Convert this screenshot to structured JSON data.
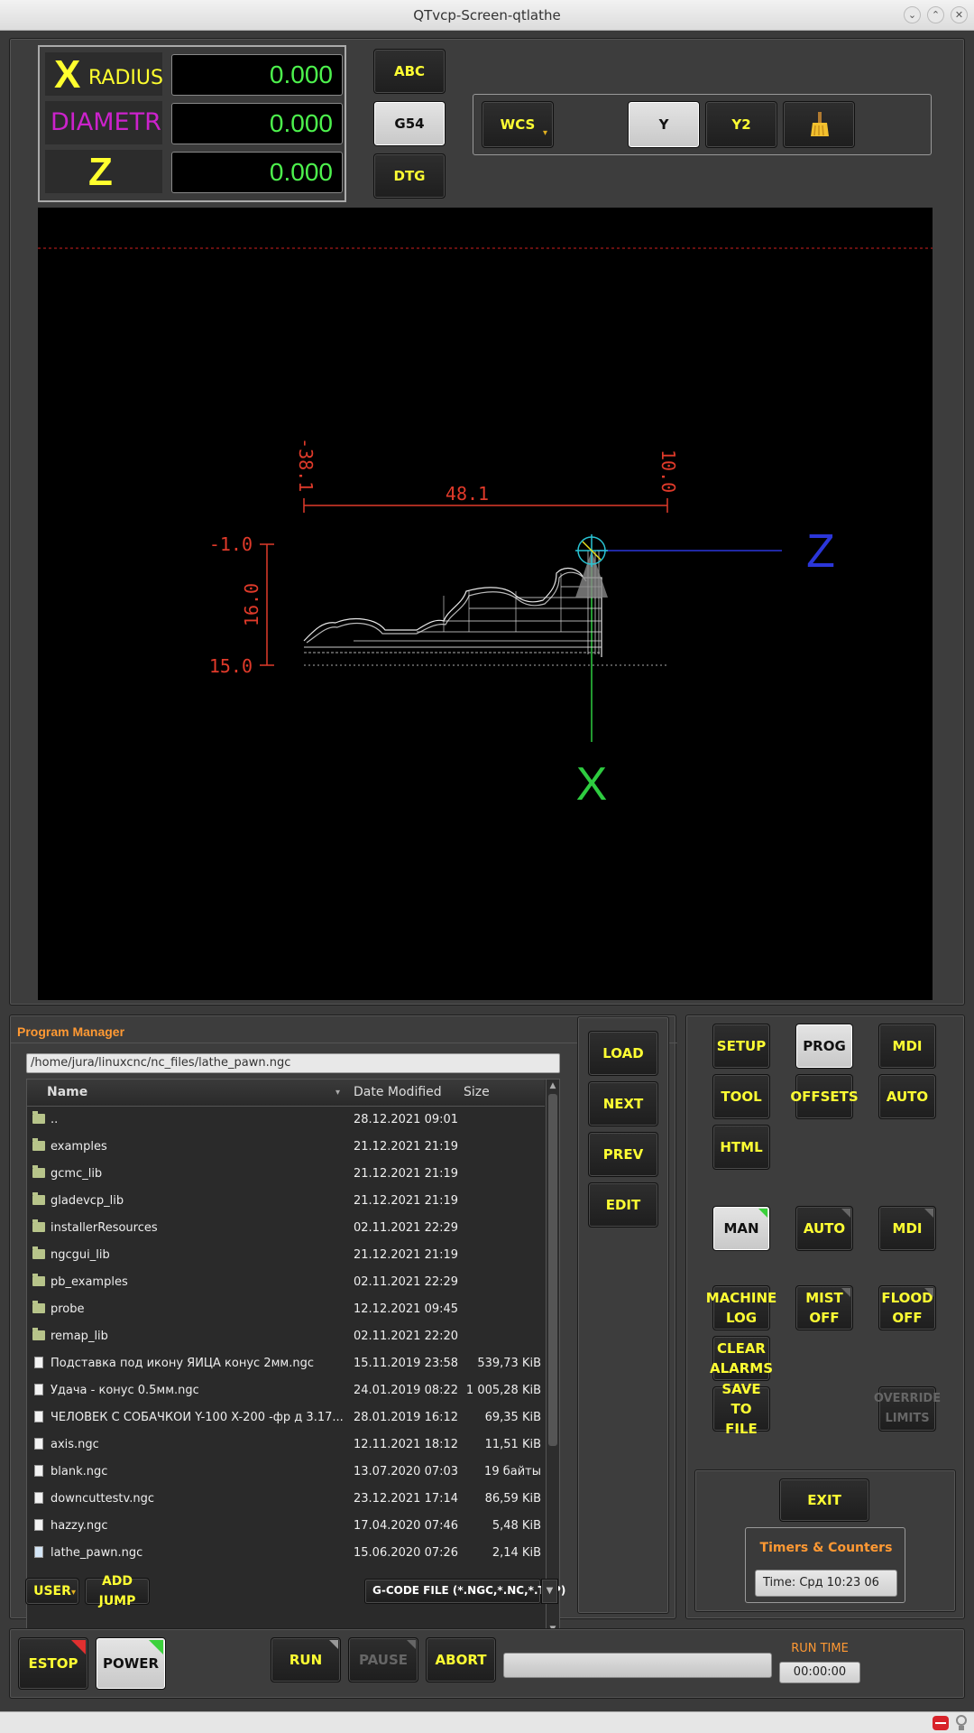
{
  "window": {
    "title": "QTvcp-Screen-qtlathe"
  },
  "dro": {
    "x_letter": "X",
    "x_sub": "RADIUS",
    "x_value": "0.000",
    "d_label": "DIAMETR",
    "d_value": "0.000",
    "z_letter": "Z",
    "z_value": "0.000"
  },
  "dro_buttons": {
    "abc": "ABC",
    "g54": "G54",
    "dtg": "DTG"
  },
  "view_buttons": {
    "wcs": "WCS",
    "y": "Y",
    "y2": "Y2",
    "clear_icon": "broom-icon"
  },
  "graphics": {
    "dim_top": "48.1",
    "dim_top_left": "-38.1",
    "dim_top_right": "10.0",
    "dim_left": "16.0",
    "dim_left_top": "-1.0",
    "dim_left_bottom": "15.0",
    "axis_z": "Z",
    "axis_x": "X",
    "colors": {
      "dimension": "#e03a2a",
      "z_axis": "#2b36d9",
      "x_axis": "#2ecc40",
      "toolpath": "#e8e8e8",
      "tool": "#29c4d4"
    }
  },
  "program_manager": {
    "title": "Program Manager",
    "path": "/home/jura/linuxcnc/nc_files/lathe_pawn.ngc",
    "columns": {
      "name": "Name",
      "date": "Date Modified",
      "size": "Size"
    },
    "files": [
      {
        "name": "..",
        "date": "28.12.2021 09:01",
        "size": "",
        "type": "folder"
      },
      {
        "name": "examples",
        "date": "21.12.2021 21:19",
        "size": "",
        "type": "folder"
      },
      {
        "name": "gcmc_lib",
        "date": "21.12.2021 21:19",
        "size": "",
        "type": "folder"
      },
      {
        "name": "gladevcp_lib",
        "date": "21.12.2021 21:19",
        "size": "",
        "type": "folder"
      },
      {
        "name": "installerResources",
        "date": "02.11.2021 22:29",
        "size": "",
        "type": "folder"
      },
      {
        "name": "ngcgui_lib",
        "date": "21.12.2021 21:19",
        "size": "",
        "type": "folder"
      },
      {
        "name": "pb_examples",
        "date": "02.11.2021 22:29",
        "size": "",
        "type": "folder"
      },
      {
        "name": "probe",
        "date": "12.12.2021 09:45",
        "size": "",
        "type": "folder"
      },
      {
        "name": "remap_lib",
        "date": "02.11.2021 22:20",
        "size": "",
        "type": "folder"
      },
      {
        "name": "Подставка под икону ЯЙЦА конус 2мм.ngc",
        "date": "15.11.2019 23:58",
        "size": "539,73 KiB",
        "type": "file"
      },
      {
        "name": "Удача - конус 0.5мм.ngc",
        "date": "24.01.2019 08:22",
        "size": "1 005,28 KiB",
        "type": "file"
      },
      {
        "name": "ЧЕЛОВЕК С СОБАЧКОЙ Y-100 X-200 -фр д 3.17...",
        "date": "28.01.2019 16:12",
        "size": "69,35 KiB",
        "type": "file"
      },
      {
        "name": "axis.ngc",
        "date": "12.11.2021 18:12",
        "size": "11,51 KiB",
        "type": "file"
      },
      {
        "name": "blank.ngc",
        "date": "13.07.2020 07:03",
        "size": "19 байты",
        "type": "file"
      },
      {
        "name": "downcuttestv.ngc",
        "date": "23.12.2021 17:14",
        "size": "86,59 KiB",
        "type": "file"
      },
      {
        "name": "hazzy.ngc",
        "date": "17.04.2020 07:46",
        "size": "5,48 KiB",
        "type": "file"
      },
      {
        "name": "lathe_pawn.ngc",
        "date": "15.06.2020 07:26",
        "size": "2,14 KiB",
        "type": "file-selected"
      }
    ],
    "user_button": "USER",
    "add_jump_button": "ADD JUMP",
    "filter": "G-CODE FILE (*.NGC,*.NC,*.TAP)"
  },
  "file_actions": {
    "load": "LOAD",
    "next": "NEXT",
    "prev": "PREV",
    "edit": "EDIT"
  },
  "mode_tabs": {
    "setup": "SETUP",
    "prog": "PROG",
    "mdi": "MDI",
    "tool": "TOOL",
    "offsets": "OFFSETS",
    "auto": "AUTO",
    "html": "HTML"
  },
  "modes": {
    "man": "MAN",
    "auto": "AUTO",
    "mdi": "MDI"
  },
  "controls": {
    "machine_log_1": "MACHINE",
    "machine_log_2": "LOG",
    "mist_1": "MIST",
    "mist_2": "OFF",
    "flood_1": "FLOOD",
    "flood_2": "OFF",
    "clear_1": "CLEAR",
    "clear_2": "ALARMS",
    "save_1": "SAVE",
    "save_2": "TO FILE",
    "override_1": "OVERRIDE",
    "override_2": "LIMITS"
  },
  "exit_button": "EXIT",
  "timers": {
    "title": "Timers & Counters",
    "value": "Time:   Срд 10:23 06"
  },
  "bottom": {
    "estop": "ESTOP",
    "power": "POWER",
    "run": "RUN",
    "pause": "PAUSE",
    "abort": "ABORT",
    "run_time_label": "RUN TIME",
    "run_time": "00:00:00"
  }
}
